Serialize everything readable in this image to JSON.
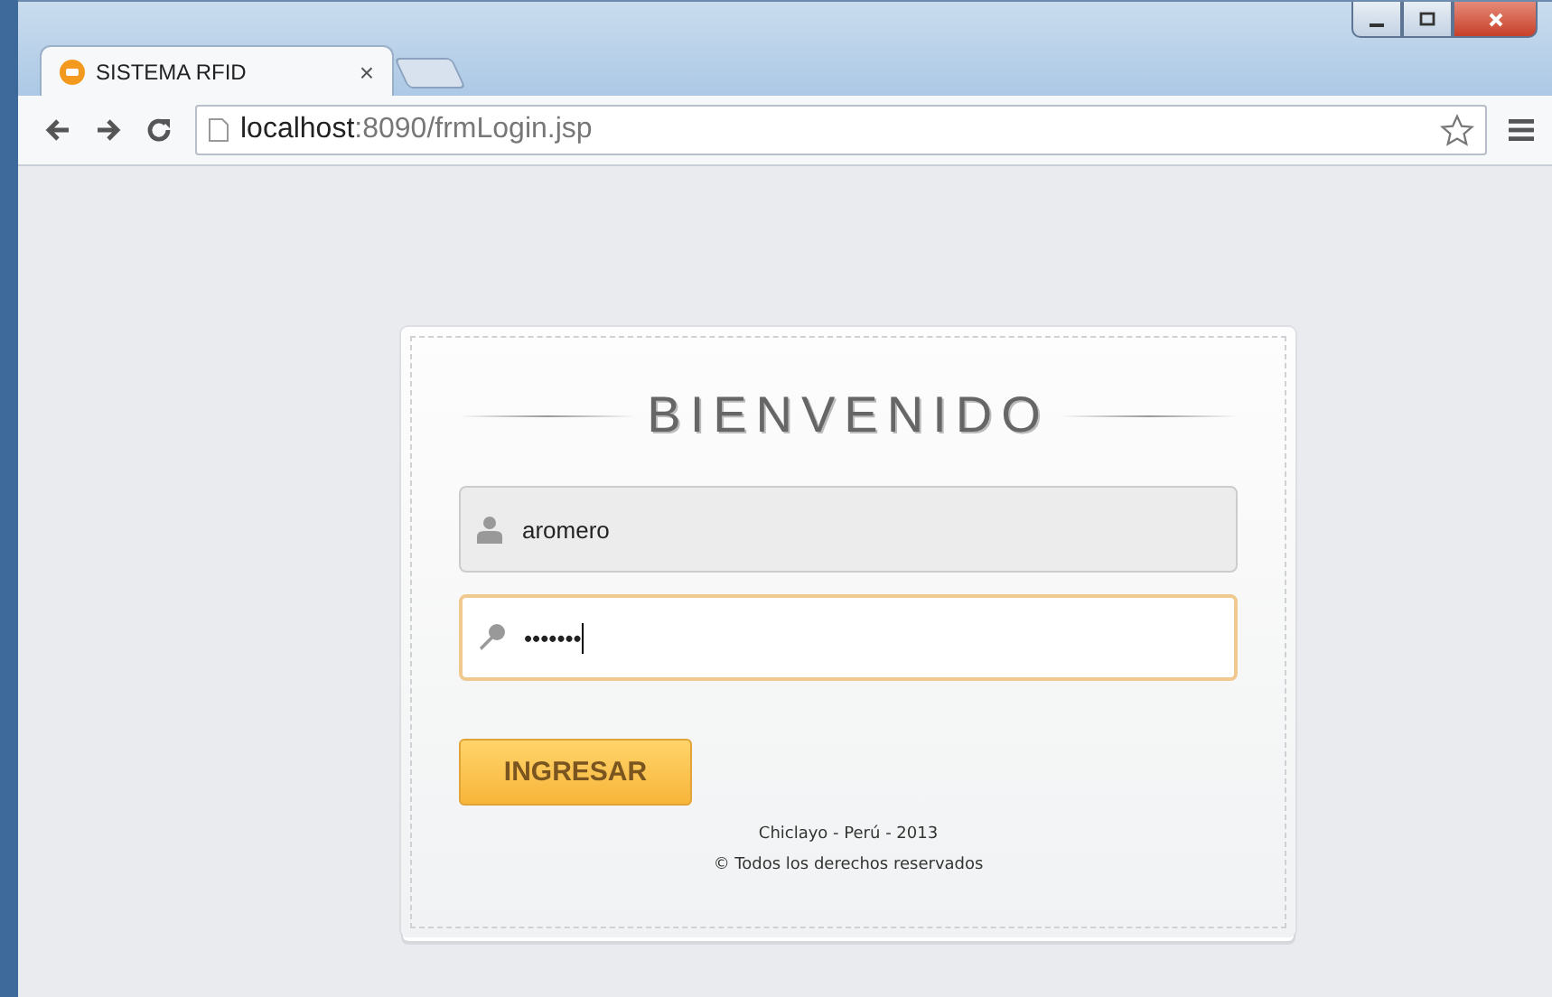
{
  "browser": {
    "tabs": [
      {
        "title": "SISTEMA RFID",
        "close": "×",
        "selected": true
      }
    ],
    "address": {
      "host": "localhost",
      "path": ":8090/frmLogin.jsp"
    }
  },
  "login": {
    "title": "BIENVENIDO",
    "fields": [
      {
        "kind": "user",
        "value": "aromero",
        "focused": false
      },
      {
        "kind": "password",
        "value": "•••••••",
        "focused": true
      }
    ],
    "submit": "INGRESAR",
    "footer": [
      "Chiclayo - Perú - 2013",
      "© Todos los derechos reservados"
    ]
  }
}
